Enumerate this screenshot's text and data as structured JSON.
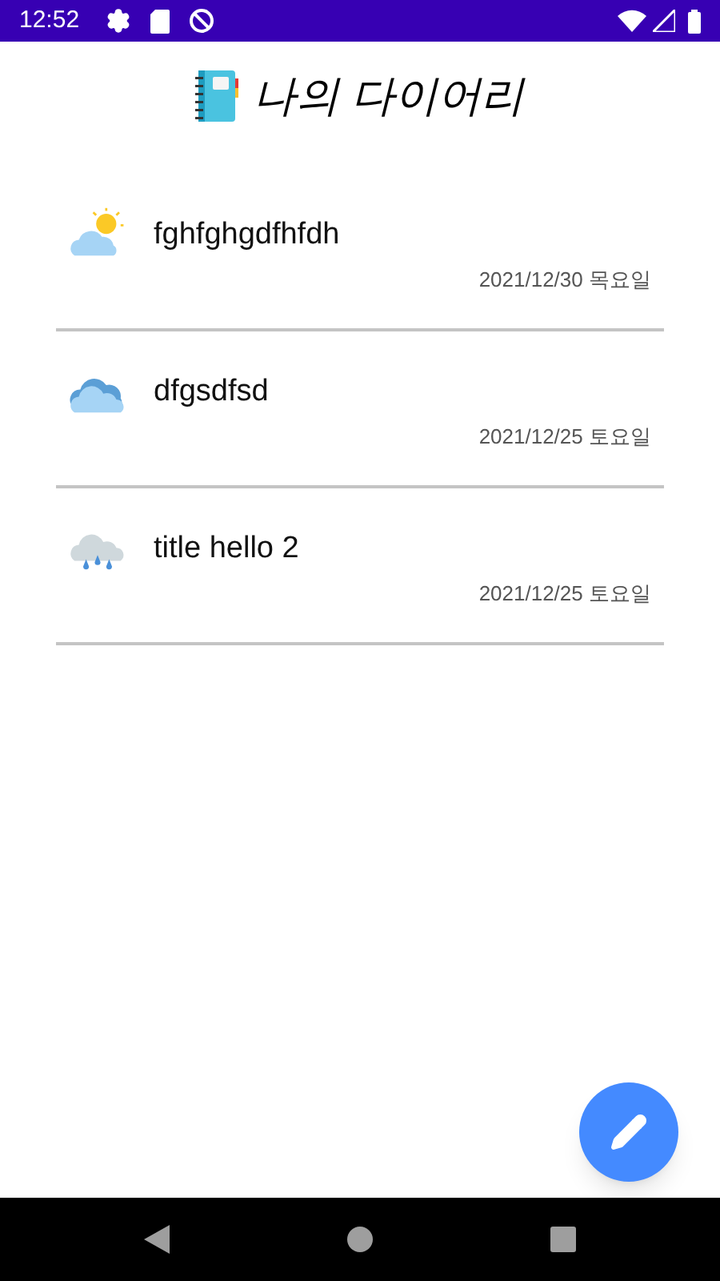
{
  "status_bar": {
    "time": "12:52"
  },
  "header": {
    "title": "나의 다이어리"
  },
  "entries": [
    {
      "kind": "sun_cloud",
      "title": "fghfghgdfhfdh",
      "date": "2021/12/30 목요일"
    },
    {
      "kind": "cloud",
      "title": "dfgsdfsd",
      "date": "2021/12/25 토요일"
    },
    {
      "kind": "rain",
      "title": "title hello 2",
      "date": "2021/12/25 토요일"
    }
  ]
}
